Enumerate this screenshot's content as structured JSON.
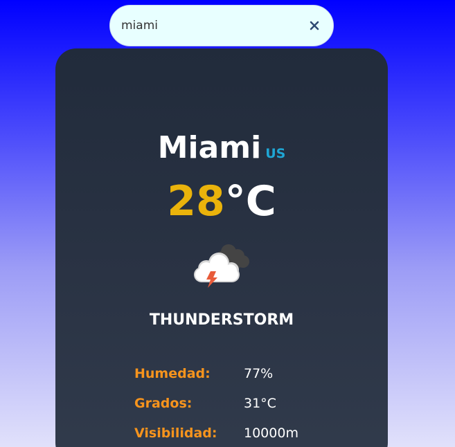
{
  "search": {
    "value": "miami",
    "placeholder": ""
  },
  "icons": {
    "clear": "close-icon",
    "weather": "thunderstorm-cloud-icon"
  },
  "weather": {
    "city": "Miami",
    "country": "US",
    "temperature": "28",
    "temperature_unit": "°C",
    "condition": "THUNDERSTORM"
  },
  "details": [
    {
      "label": "Humedad:",
      "value": "77%"
    },
    {
      "label": "Grados:",
      "value": "31°C"
    },
    {
      "label": "Visibilidad:",
      "value": "10000m"
    }
  ],
  "colors": {
    "background_top": "#0000ff",
    "card": "#232c3c",
    "temperature": "#eab30b",
    "country": "#1fa6d4",
    "label": "#f7941d"
  }
}
